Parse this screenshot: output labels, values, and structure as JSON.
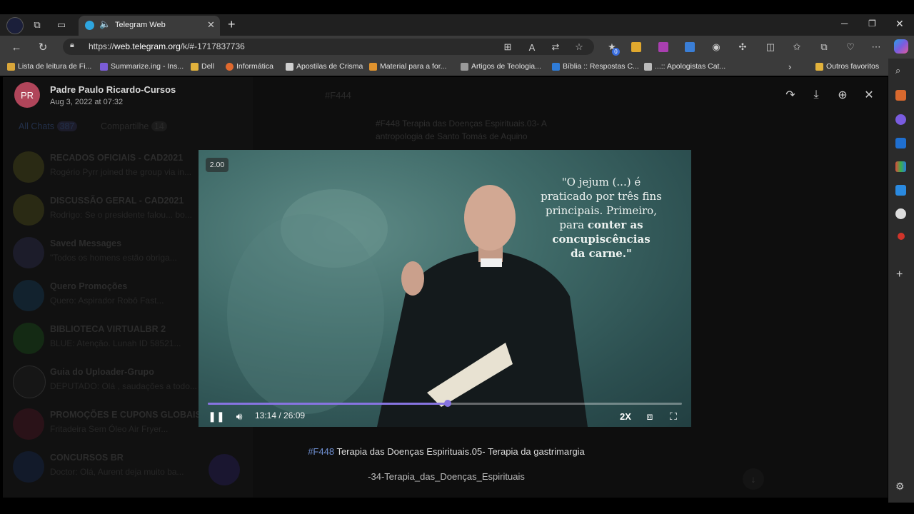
{
  "browser": {
    "tab_title": "Telegram Web",
    "url_prefix": "https://",
    "url_host": "web.telegram.org",
    "url_path": "/k/#-1717837736",
    "bookmarks": [
      {
        "label": "Lista de leitura de Fi...",
        "color": "#d9a63a"
      },
      {
        "label": "Summarize.ing - Ins...",
        "color": "#7a5cd6"
      },
      {
        "label": "Dell",
        "color": "#e2b23c"
      },
      {
        "label": "Informática",
        "color": "#e0692e"
      },
      {
        "label": "Apostilas de Crisma",
        "color": "#cfcfcf"
      },
      {
        "label": "Material para a for...",
        "color": "#e0932e"
      },
      {
        "label": "Artigos de Teologia...",
        "color": "#9a9a9a"
      },
      {
        "label": "Bíblia :: Respostas C...",
        "color": "#2f7bd6"
      },
      {
        "label": "...:: Apologistas Cat...",
        "color": "#bbbbbb"
      }
    ],
    "other_favorites": "Outros favoritos",
    "badge_count": "0"
  },
  "telegram": {
    "tabs": {
      "all": "All Chats",
      "all_count": "387",
      "shared": "Compartilhe",
      "shared_count": "14"
    },
    "chats": [
      {
        "name": "RECADOS OFICIAIS - CAD2021",
        "preview": "Rogério Pyrr joined the group via in...",
        "color": "#4a4a20"
      },
      {
        "name": "DISCUSSÃO GERAL - CAD2021",
        "preview": "Rodrigo: Se o presidente falou... bo...",
        "color": "#4a4a20"
      },
      {
        "name": "Saved Messages",
        "preview": "\"Todos os homens estão obriga...",
        "color": "#33334a"
      },
      {
        "name": "Quero Promoções",
        "preview": "Quero: Aspirador Robô Fast...",
        "color": "#23405a"
      },
      {
        "name": "BIBLIOTECA VIRTUALBR 2",
        "preview": "BLUE: Atenção. Lunah ID 58521...",
        "color": "#224a24"
      },
      {
        "name": "Guia do Uploader-Grupo",
        "preview": "DEPUTADO: Olá , saudações a todo...",
        "color": "#2a2a2a"
      },
      {
        "name": "PROMOÇÕES E CUPONS GLOBAIS",
        "preview": "Fritadeira Sem Óleo Air Fryer...",
        "color": "#4a2230"
      },
      {
        "name": "CONCURSOS BR",
        "preview": "Doctor: Olá, Aurent deja muito ba...",
        "color": "#22304a"
      }
    ],
    "chat_header_tag": "#F444",
    "pinned_text": "#F448 Terapia das Doenças Espirituais.03- A antropologia de Santo Tomás de Aquino"
  },
  "viewer": {
    "avatar_initials": "PR",
    "sender": "Padre Paulo Ricardo-Cursos",
    "date": "Aug 3, 2022 at 07:32",
    "speed_badge": "2.00",
    "quote_line1": "\"O jejum (...) é",
    "quote_line2": "praticado por três fins",
    "quote_line3": "principais. Primeiro,",
    "quote_line4_plain": "para ",
    "quote_line4_bold": "conter as",
    "quote_line5": "concupiscências",
    "quote_line6": "da carne.\"",
    "time": "13:14 / 26:09",
    "progress": 0.506,
    "speed_label": "2X",
    "caption_tag": "#F448",
    "caption_text": " Terapia das Doenças Espirituais.05- Terapia da gastrimargia",
    "caption_sub": "-34-Terapia_das_Doenças_Espirituais",
    "accent": "#8774e1"
  }
}
